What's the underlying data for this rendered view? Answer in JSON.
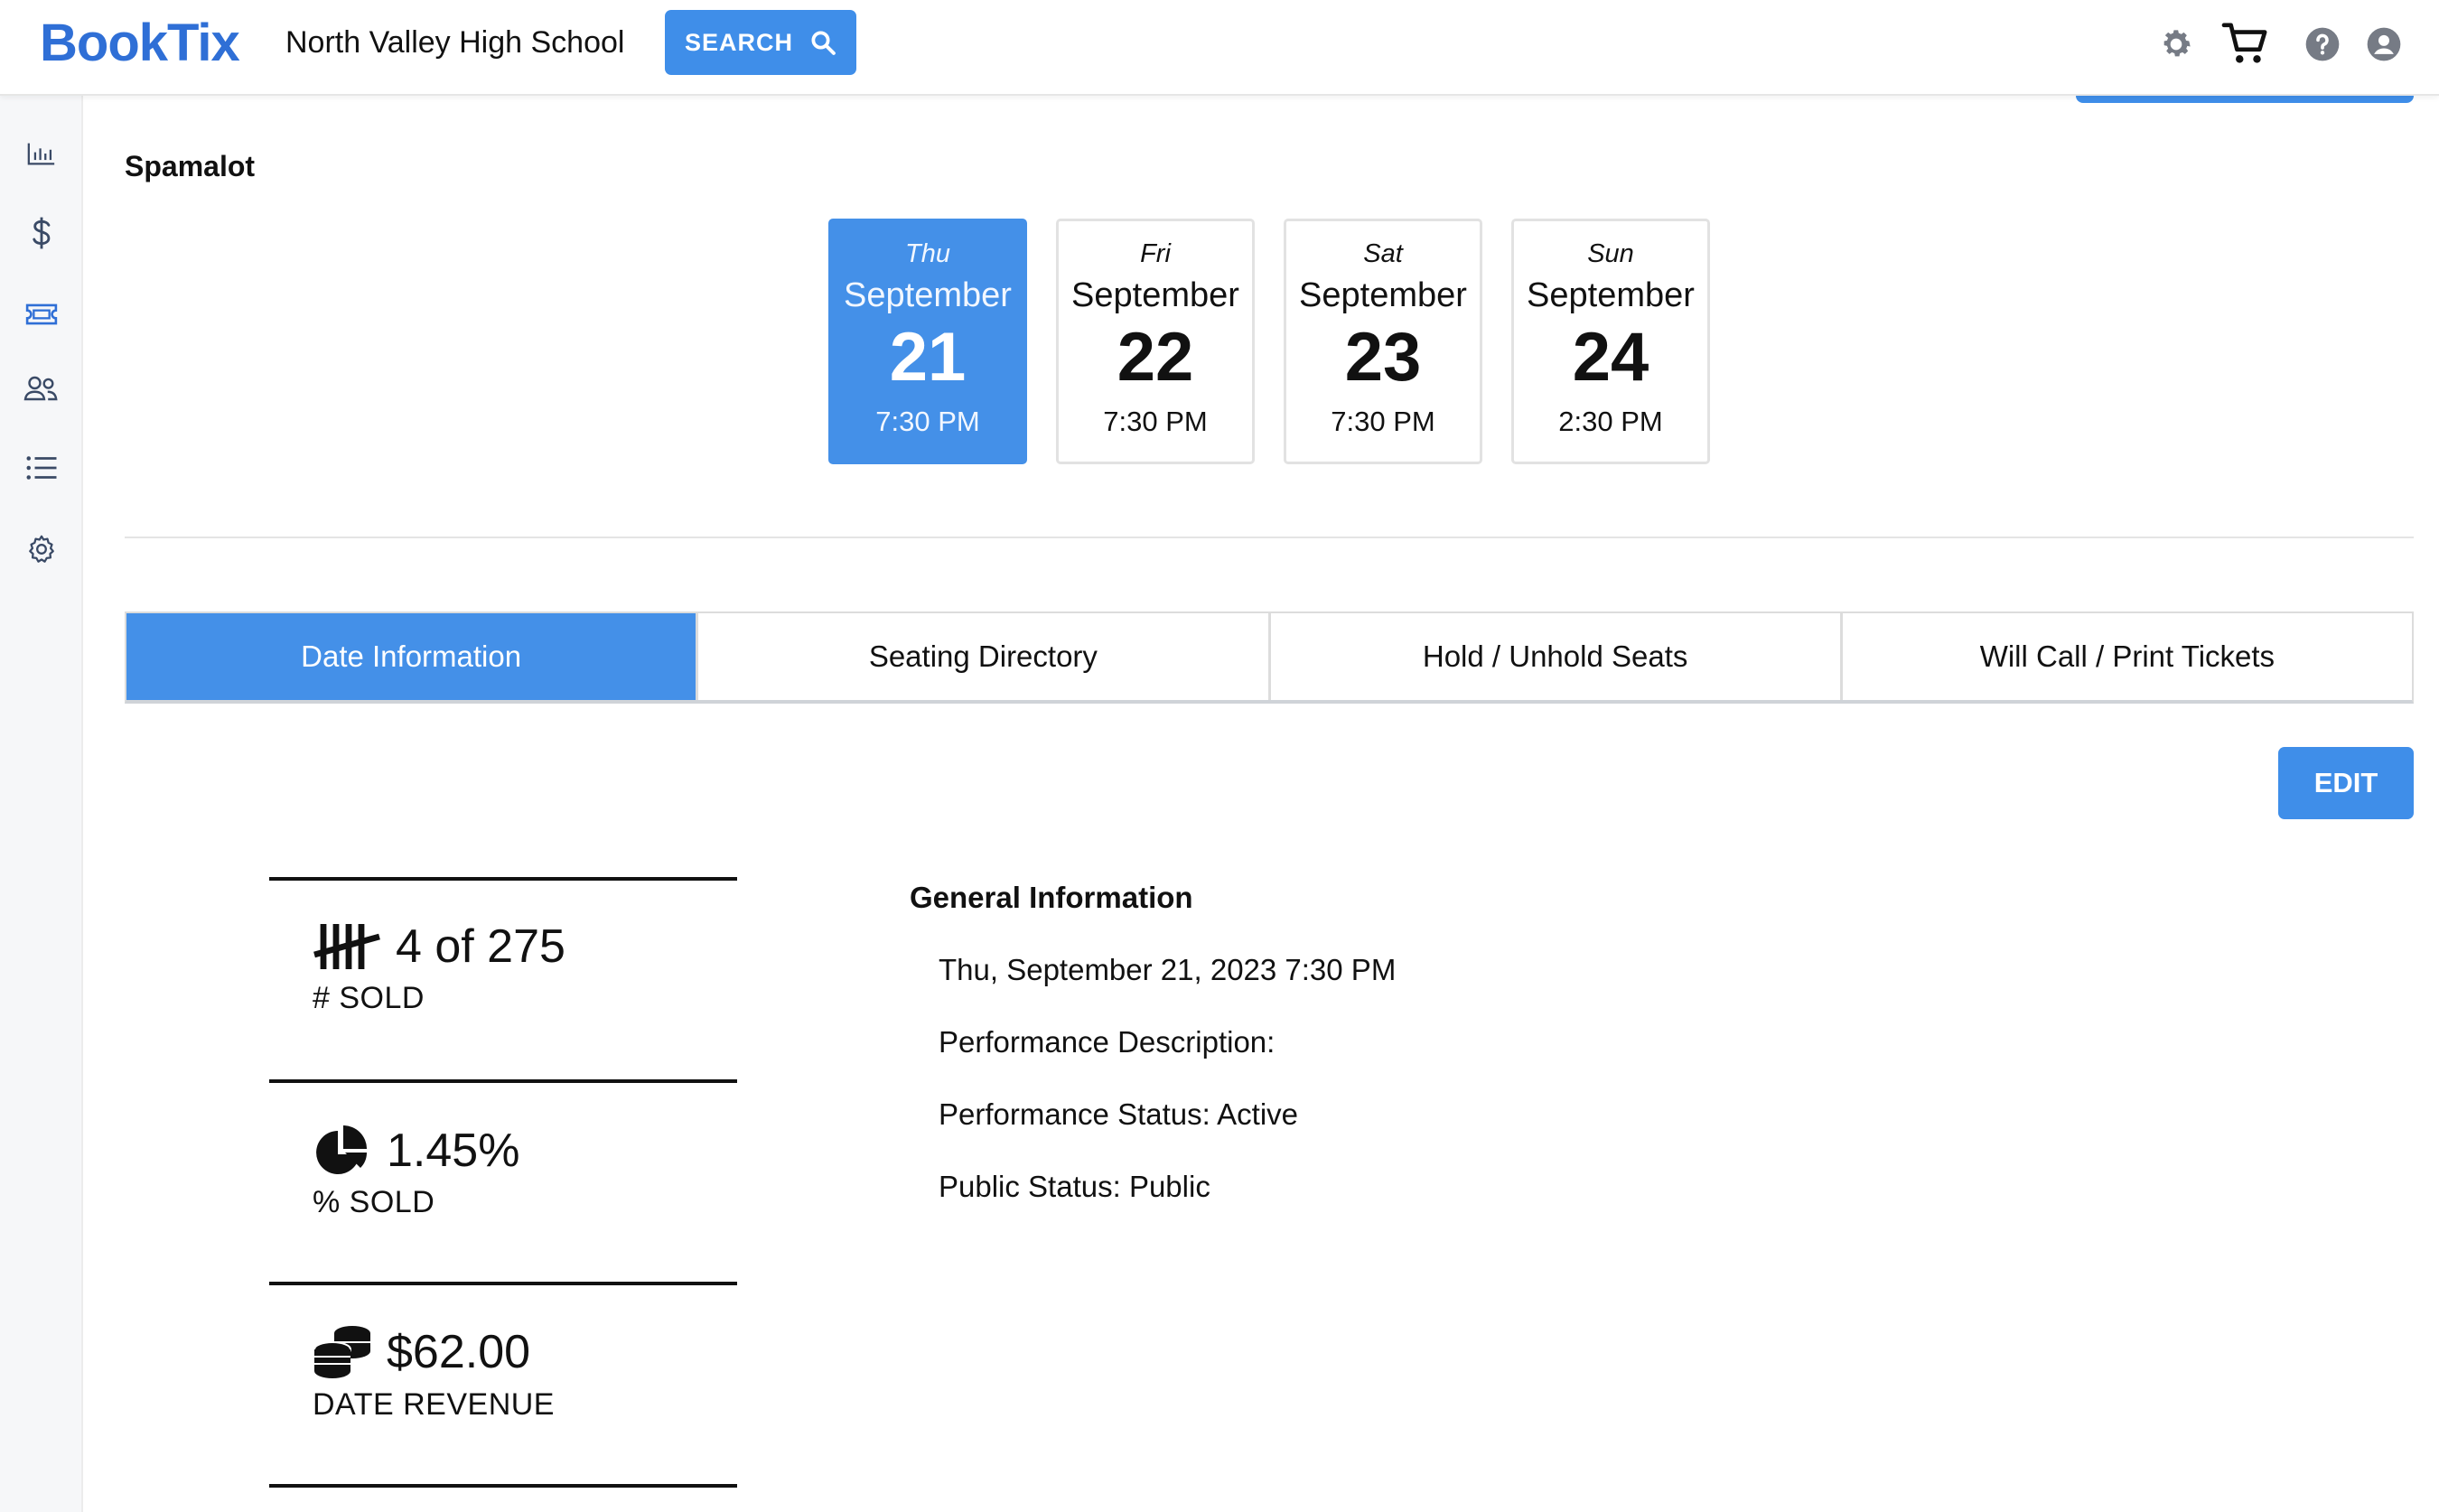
{
  "header": {
    "logo": "BookTix",
    "school": "North Valley High School",
    "search_label": "SEARCH",
    "icons": [
      "gear-icon",
      "cart-icon",
      "help-icon",
      "user-icon"
    ]
  },
  "sidebar": {
    "icons": [
      "chart-icon",
      "dollar-icon",
      "ticket-icon",
      "users-icon",
      "list-icon",
      "settings-icon"
    ]
  },
  "show": {
    "title": "Spamalot"
  },
  "dates": [
    {
      "dow": "Thu",
      "month": "September",
      "day": "21",
      "time": "7:30 PM",
      "active": true
    },
    {
      "dow": "Fri",
      "month": "September",
      "day": "22",
      "time": "7:30 PM",
      "active": false
    },
    {
      "dow": "Sat",
      "month": "September",
      "day": "23",
      "time": "7:30 PM",
      "active": false
    },
    {
      "dow": "Sun",
      "month": "September",
      "day": "24",
      "time": "2:30 PM",
      "active": false
    }
  ],
  "tabs": [
    {
      "label": "Date Information",
      "active": true
    },
    {
      "label": "Seating Directory",
      "active": false
    },
    {
      "label": "Hold / Unhold Seats",
      "active": false
    },
    {
      "label": "Will Call / Print Tickets",
      "active": false
    }
  ],
  "edit_label": "EDIT",
  "stats": {
    "sold": {
      "value": "4 of 275",
      "label": "# SOLD"
    },
    "percent": {
      "value": "1.45%",
      "label": "% SOLD"
    },
    "revenue": {
      "value": "$62.00",
      "label": "DATE REVENUE"
    }
  },
  "general": {
    "title": "General Information",
    "datetime": "Thu, September 21, 2023 7:30 PM",
    "description": "Performance Description:",
    "status": "Performance Status: Active",
    "public_status": "Public Status: Public"
  },
  "colors": {
    "primary": "#3f8ee9",
    "logo": "#2f6fd6"
  }
}
